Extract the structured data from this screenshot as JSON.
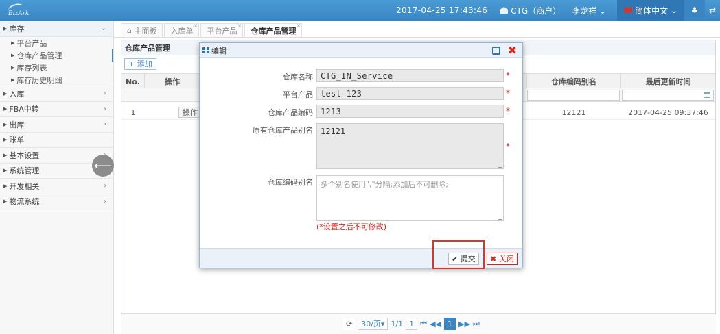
{
  "topbar": {
    "logo": "BizArk",
    "datetime": "2017-04-25 17:43:46",
    "org": "CTG（商户）",
    "user": "李龙祥",
    "language": "简体中文"
  },
  "sidebar": {
    "sections": [
      {
        "label": "库存"
      },
      {
        "label": "入库"
      },
      {
        "label": "FBA中转"
      },
      {
        "label": "出库"
      },
      {
        "label": "账单"
      },
      {
        "label": "基本设置"
      },
      {
        "label": "系统管理"
      },
      {
        "label": "开发相关"
      },
      {
        "label": "物流系统"
      }
    ],
    "sub": [
      "平台产品",
      "仓库产品管理",
      "库存列表",
      "库存历史明细"
    ]
  },
  "tabs": [
    "主面板",
    "入库单",
    "平台产品",
    "仓库产品管理"
  ],
  "panel": {
    "title": "仓库产品管理",
    "add": "添加",
    "columns": {
      "no": "No.",
      "op": "操作",
      "alias": "仓库编码别名",
      "updated": "最后更新时间"
    },
    "row": {
      "no": "1",
      "op": "操作",
      "alias": "12121",
      "updated": "2017-04-25 09:37:46"
    }
  },
  "pager": {
    "per_page": "30/页",
    "pages": "1/1",
    "page_input": "1",
    "current": "1"
  },
  "modal": {
    "title": "编辑",
    "fields": {
      "name_label": "仓库名称",
      "name_value": "CTG_IN_Service",
      "platform_label": "平台产品",
      "platform_value": "test-123",
      "code_label": "仓库产品编码",
      "code_value": "1213",
      "orig_alias_label": "原有仓库产品别名",
      "orig_alias_value": "12121",
      "alias_label": "仓库编码别名",
      "alias_placeholder": "多个别名使用\",\"分隔;添加后不可删除;"
    },
    "required_mark": "*",
    "hint": "(*设置之后不可修改)",
    "submit": "提交",
    "close": "关闭"
  }
}
